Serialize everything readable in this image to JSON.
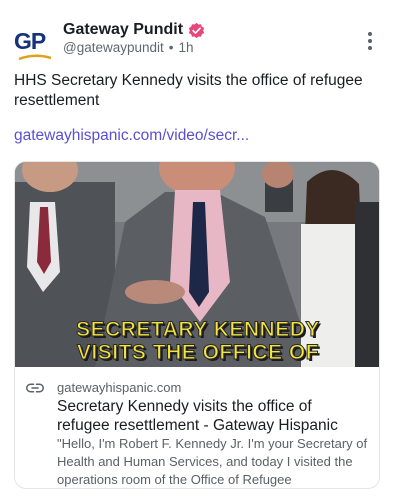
{
  "author": {
    "avatar_text": "GP",
    "name": "Gateway Pundit",
    "handle": "@gatewaypundit",
    "separator": "•",
    "time": "1h",
    "verified_color": "#e8457a"
  },
  "post": {
    "text": "HHS Secretary Kennedy visits the office of refugee resettlement",
    "link_text": "gatewayhispanic.com/video/secr..."
  },
  "link_card": {
    "image_caption_line1": "SECRETARY KENNEDY",
    "image_caption_line2": "VISITS THE OFFICE OF",
    "domain": "gatewayhispanic.com",
    "title": "Secretary Kennedy visits the office of refugee resettlement - Gateway Hispanic",
    "description": "\"Hello, I'm Robert F. Kennedy Jr. I'm your Secretary of Health and Human Services, and today I visited the operations room of the Office of Refugee"
  },
  "colors": {
    "link": "#5a4fcf",
    "caption_yellow": "#f5e43a"
  }
}
